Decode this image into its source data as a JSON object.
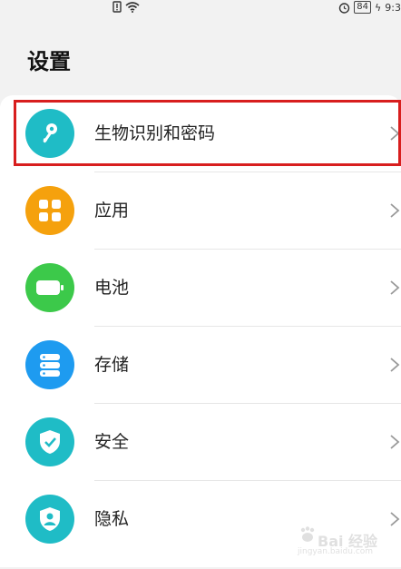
{
  "status_bar": {
    "battery_level": "84",
    "time": "9:3"
  },
  "page": {
    "title": "设置"
  },
  "items": [
    {
      "label": "生物识别和密码",
      "icon": "key-icon",
      "color": "#1fbcc6"
    },
    {
      "label": "应用",
      "icon": "apps-grid-icon",
      "color": "#f5a10d"
    },
    {
      "label": "电池",
      "icon": "battery-icon",
      "color": "#3cc94a"
    },
    {
      "label": "存储",
      "icon": "storage-icon",
      "color": "#1e9bf0"
    },
    {
      "label": "安全",
      "icon": "shield-check-icon",
      "color": "#1fbcc6"
    },
    {
      "label": "隐私",
      "icon": "privacy-icon",
      "color": "#1fbcc6"
    }
  ],
  "highlighted_item": "生物识别和密码",
  "watermark": {
    "text": "Bai 经验",
    "sub": "jingyan.baidu.com"
  }
}
